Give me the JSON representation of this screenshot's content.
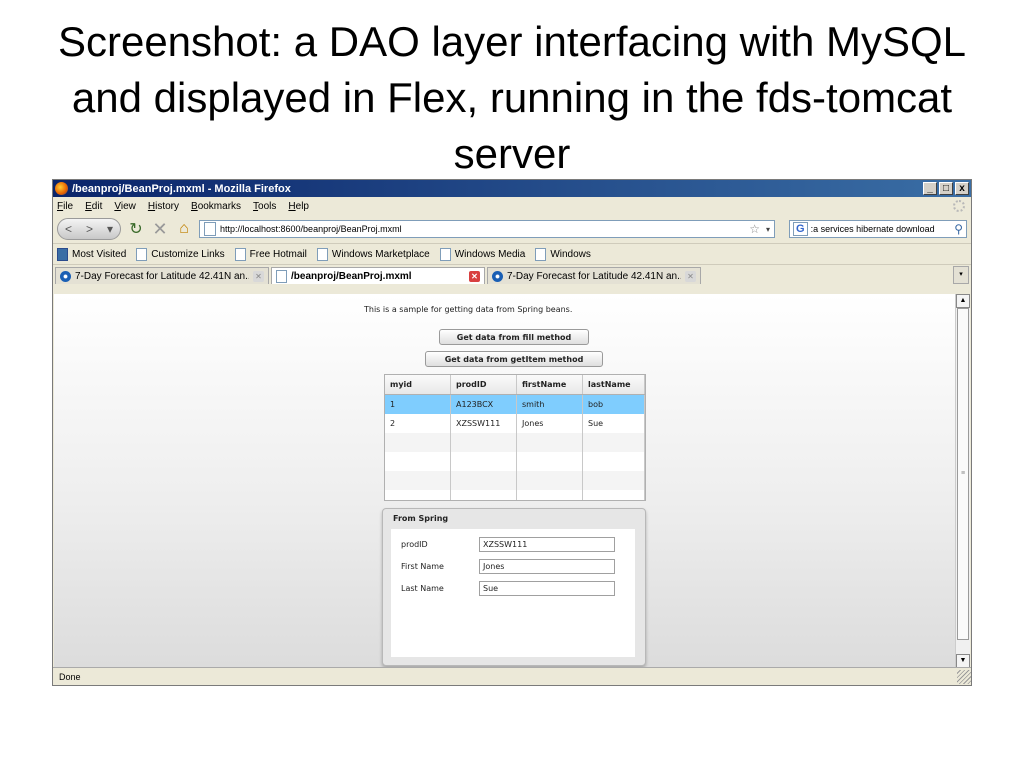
{
  "slide": {
    "title": "Screenshot: a DAO layer interfacing with MySQL and displayed in Flex, running in the fds-tomcat server"
  },
  "window": {
    "title": "/beanproj/BeanProj.mxml - Mozilla Firefox",
    "minimize": "_",
    "maximize": "□",
    "close": "x"
  },
  "menu": [
    "File",
    "Edit",
    "View",
    "History",
    "Bookmarks",
    "Tools",
    "Help"
  ],
  "nav": {
    "back": "<",
    "forward": ">",
    "url": "http://localhost:8600/beanproj/BeanProj.mxml",
    "search_text": ":a services hibernate download"
  },
  "bookmarks": [
    "Most Visited",
    "Customize Links",
    "Free Hotmail",
    "Windows Marketplace",
    "Windows Media",
    "Windows"
  ],
  "tabs": [
    {
      "label": "7-Day Forecast for Latitude 42.41N an..."
    },
    {
      "label": "/beanproj/BeanProj.mxml"
    },
    {
      "label": "7-Day Forecast for Latitude 42.41N an..."
    }
  ],
  "app": {
    "intro": "This is a sample for getting data from Spring beans.",
    "fill_button": "Get data from fill method",
    "getitem_button": "Get data from getItem method",
    "grid": {
      "columns": [
        "myid",
        "prodID",
        "firstName",
        "lastName"
      ],
      "rows": [
        [
          "1",
          "A123BCX",
          "smith",
          "bob"
        ],
        [
          "2",
          "XZSSW111",
          "Jones",
          "Sue"
        ]
      ]
    },
    "panel": {
      "title": "From Spring",
      "prodid_label": "prodID",
      "prodid_value": "XZSSW111",
      "firstname_label": "First Name",
      "firstname_value": "Jones",
      "lastname_label": "Last Name",
      "lastname_value": "Sue"
    }
  },
  "status": {
    "text": "Done"
  },
  "colors": {
    "selected_row": "#7fcdfe",
    "titlebar": "#0a246a"
  }
}
